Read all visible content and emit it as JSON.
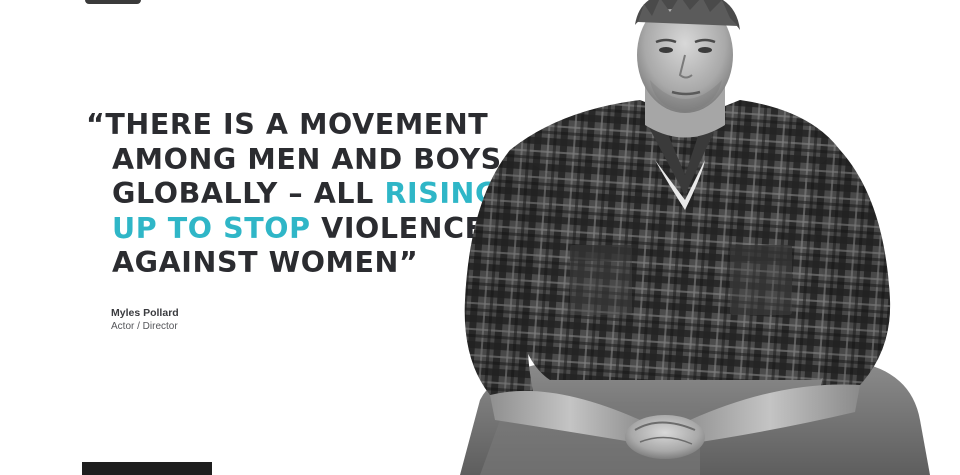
{
  "quote": {
    "open_mark": "“",
    "close_mark": "”",
    "line1": "THERE IS A MOVEMENT",
    "line2": "AMONG MEN AND BOYS",
    "line3_plain": "GLOBALLY – ALL ",
    "line3_accent": "RISING",
    "line4_accent": "UP TO STOP",
    "line4_plain": " VIOLENCE",
    "line5": "AGAINST WOMEN"
  },
  "attribution": {
    "name": "Myles Pollard",
    "role": "Actor / Director"
  },
  "colors": {
    "accent": "#2fb6c7",
    "text": "#2b2c30",
    "background": "#ffffff"
  }
}
